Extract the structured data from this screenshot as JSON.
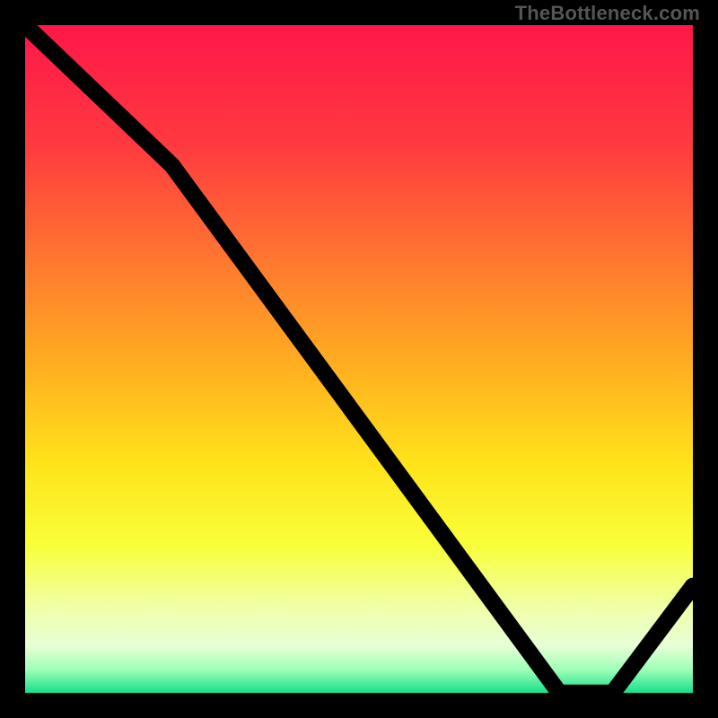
{
  "watermark": "TheBottleneck.com",
  "baseline_label": "",
  "chart_data": {
    "type": "line",
    "title": "",
    "xlabel": "",
    "ylabel": "",
    "xlim": [
      0,
      100
    ],
    "ylim": [
      0,
      100
    ],
    "x": [
      0,
      22,
      80,
      88,
      100
    ],
    "values": [
      100,
      79,
      0,
      0,
      16
    ],
    "gradient_stops": [
      {
        "offset": 0.0,
        "color": "#ff1749"
      },
      {
        "offset": 0.18,
        "color": "#ff3a3f"
      },
      {
        "offset": 0.36,
        "color": "#ff7a2f"
      },
      {
        "offset": 0.52,
        "color": "#ffb21f"
      },
      {
        "offset": 0.66,
        "color": "#ffe41a"
      },
      {
        "offset": 0.78,
        "color": "#f8ff3a"
      },
      {
        "offset": 0.88,
        "color": "#f0ffb0"
      },
      {
        "offset": 0.93,
        "color": "#e6ffd6"
      },
      {
        "offset": 0.965,
        "color": "#9fffb8"
      },
      {
        "offset": 1.0,
        "color": "#15e08a"
      }
    ],
    "baseline_label_pos": {
      "x_pct": 80.5,
      "y_pct": 98.2
    }
  }
}
